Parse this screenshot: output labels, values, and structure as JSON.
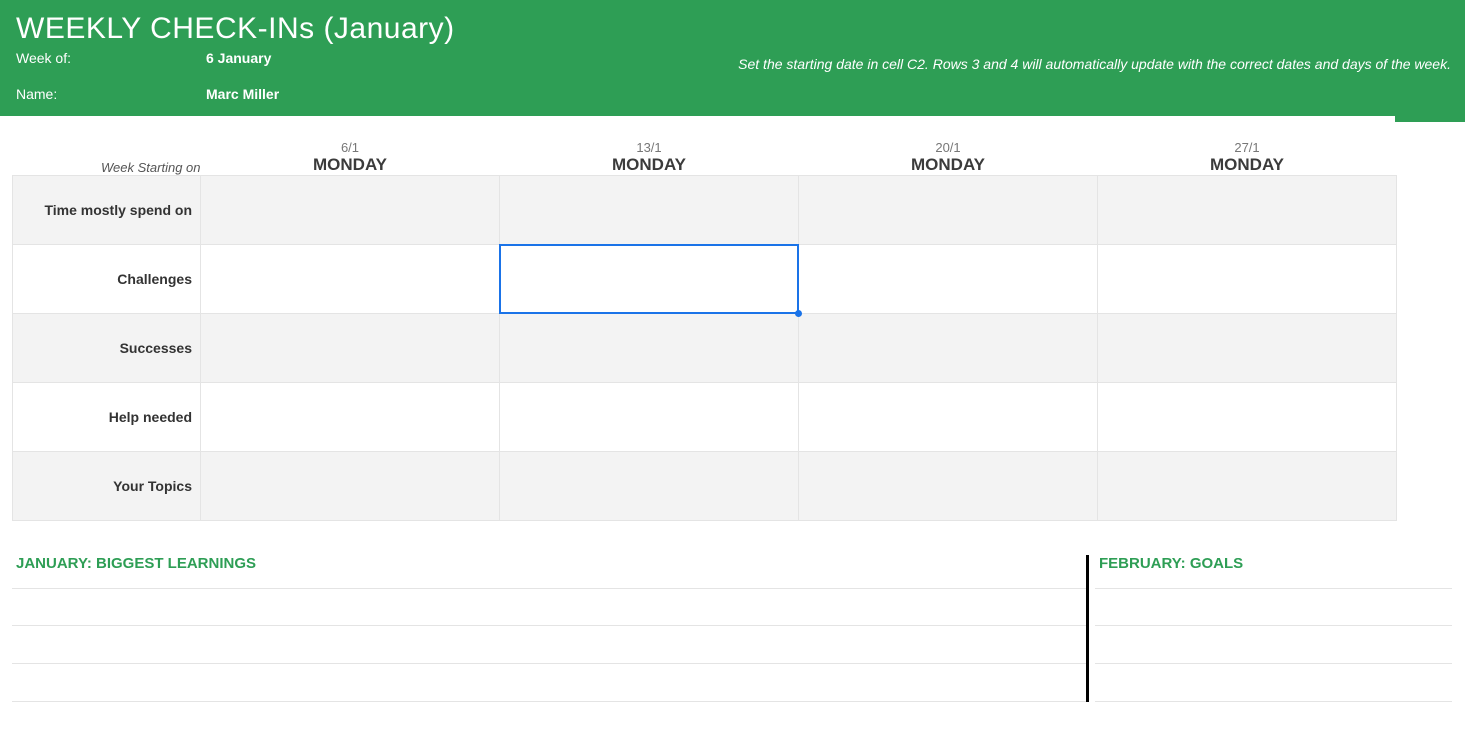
{
  "colors": {
    "brand_green": "#2e9e55",
    "selection_blue": "#1a73e8"
  },
  "header": {
    "title": "WEEKLY CHECK-INs (January)",
    "week_of_label": "Week of:",
    "week_of_value": "6 January",
    "name_label": "Name:",
    "name_value": "Marc Miller",
    "note": "Set the starting date in cell C2. Rows 3 and 4 will automatically update with the correct dates and days of the week."
  },
  "table": {
    "week_starting_label": "Week Starting on",
    "columns": [
      {
        "date": "6/1",
        "day": "MONDAY"
      },
      {
        "date": "13/1",
        "day": "MONDAY"
      },
      {
        "date": "20/1",
        "day": "MONDAY"
      },
      {
        "date": "27/1",
        "day": "MONDAY"
      }
    ],
    "rows": [
      {
        "label": "Time mostly spend on",
        "shade": true
      },
      {
        "label": "Challenges",
        "shade": false
      },
      {
        "label": "Successes",
        "shade": true
      },
      {
        "label": "Help needed",
        "shade": false
      },
      {
        "label": "Your Topics",
        "shade": true
      }
    ],
    "selected": {
      "row": 1,
      "col": 1
    }
  },
  "bottom": {
    "learnings_title": "JANUARY: BIGGEST LEARNINGS",
    "goals_title": "FEBRUARY: GOALS",
    "blank_rows": 3
  }
}
